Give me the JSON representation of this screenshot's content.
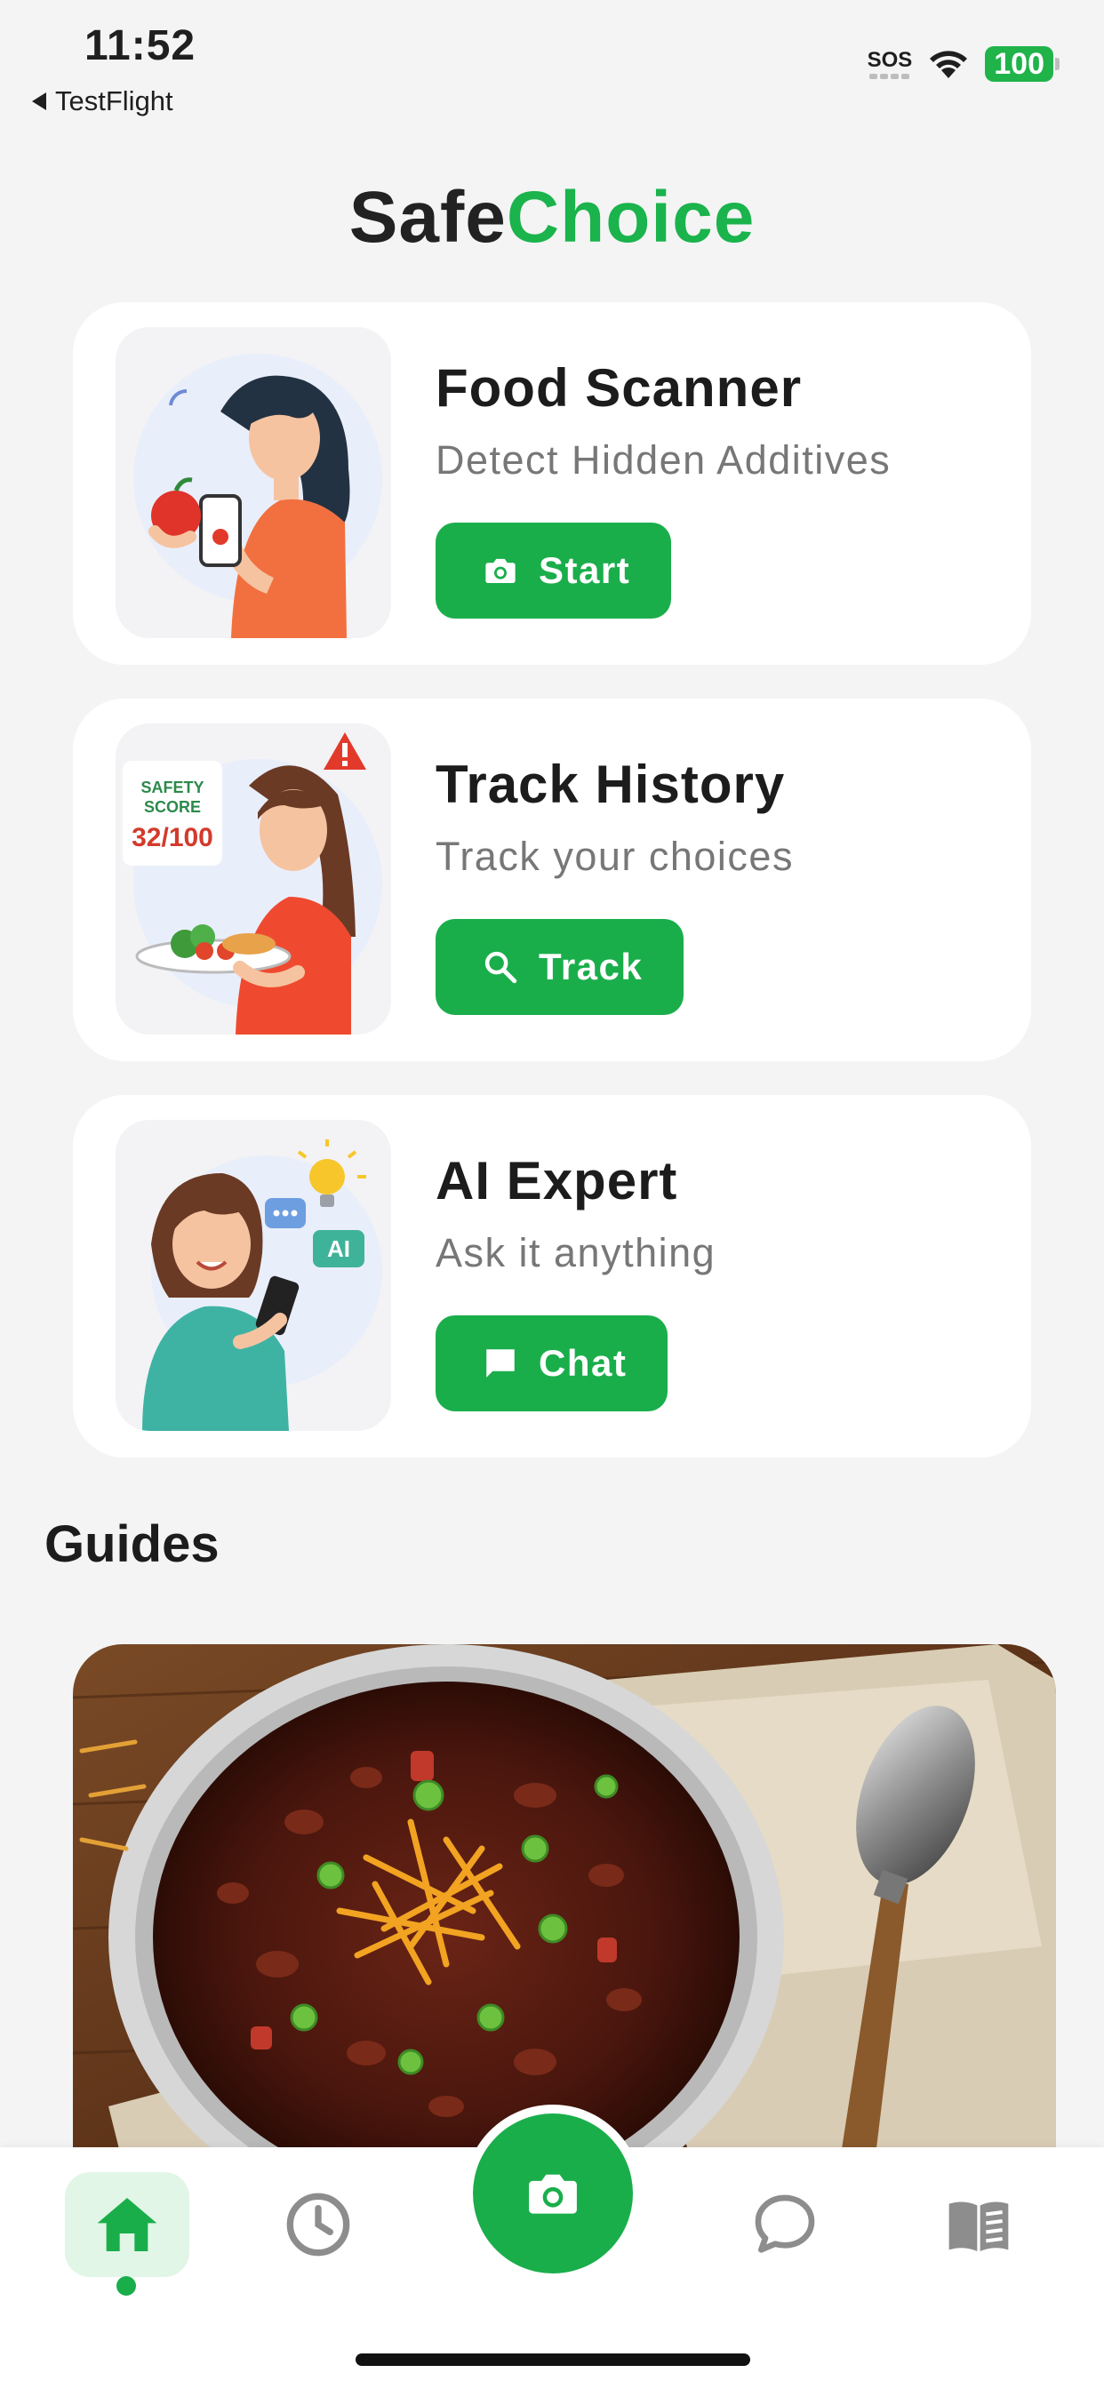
{
  "status_bar": {
    "time": "11:52",
    "back_label": "TestFlight",
    "sos": "SOS",
    "battery": "100",
    "battery_color": "#1fb34a"
  },
  "app": {
    "title_part1": "Safe",
    "title_part2": "Choice",
    "accent_color": "#1aae4b"
  },
  "cards": [
    {
      "title": "Food Scanner",
      "subtitle": "Detect Hidden Additives",
      "button_label": "Start",
      "button_icon": "camera-icon"
    },
    {
      "title": "Track History",
      "subtitle": "Track your choices",
      "button_label": "Track",
      "button_icon": "search-icon",
      "illustration_text": {
        "line1": "SAFETY",
        "line2": "SCORE",
        "score": "32/100"
      }
    },
    {
      "title": "AI Expert",
      "subtitle": "Ask it anything",
      "button_label": "Chat",
      "button_icon": "chat-icon",
      "illustration_text": {
        "badge": "AI"
      }
    }
  ],
  "guides": {
    "heading": "Guides"
  },
  "tab_bar": {
    "items": [
      "home-icon",
      "clock-icon",
      "camera-icon",
      "chat-bubble-icon",
      "book-icon"
    ],
    "active": "home-icon"
  }
}
